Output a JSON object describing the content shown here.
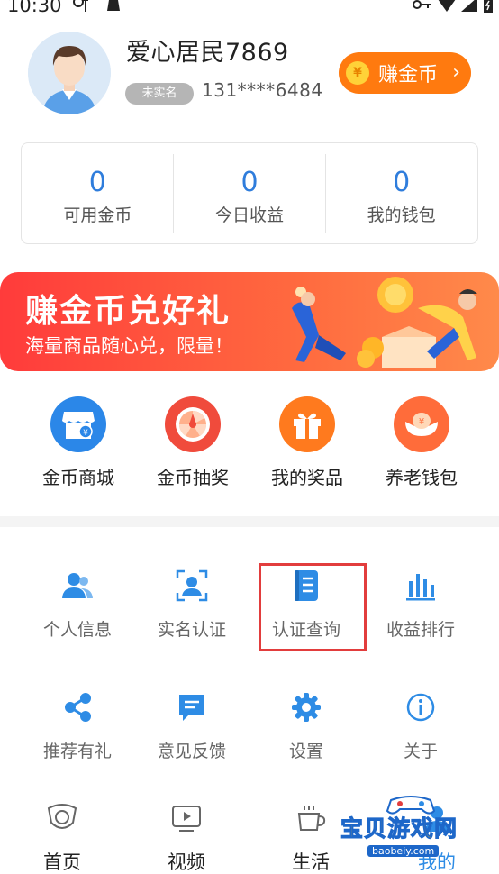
{
  "status_bar": {
    "time": "10:30"
  },
  "profile": {
    "username": "爱心居民7869",
    "verify_badge": "未实名",
    "phone": "131****6484",
    "earn_button": {
      "label": "赚金币",
      "coin_glyph": "¥",
      "chevron": "›"
    }
  },
  "stats": [
    {
      "value": "0",
      "label": "可用金币"
    },
    {
      "value": "0",
      "label": "今日收益"
    },
    {
      "value": "0",
      "label": "我的钱包"
    }
  ],
  "banner": {
    "title": "赚金币兑好礼",
    "subtitle": "海量商品随心兑，限量！"
  },
  "quick_actions": [
    {
      "label": "金币商城",
      "icon": "store-icon",
      "color": "#2b87e8"
    },
    {
      "label": "金币抽奖",
      "icon": "wheel-icon",
      "color": "#f04b3c"
    },
    {
      "label": "我的奖品",
      "icon": "gift-icon",
      "color": "#ff7a1e"
    },
    {
      "label": "养老钱包",
      "icon": "ingot-icon",
      "color": "#ff6c3a"
    }
  ],
  "services": [
    {
      "label": "个人信息",
      "icon": "user-info-icon"
    },
    {
      "label": "实名认证",
      "icon": "face-verify-icon"
    },
    {
      "label": "认证查询",
      "icon": "document-query-icon"
    },
    {
      "label": "收益排行",
      "icon": "ranking-bars-icon"
    },
    {
      "label": "推荐有礼",
      "icon": "share-icon"
    },
    {
      "label": "意见反馈",
      "icon": "feedback-icon"
    },
    {
      "label": "设置",
      "icon": "gear-icon"
    },
    {
      "label": "关于",
      "icon": "info-icon"
    }
  ],
  "bottom_nav": [
    {
      "label": "首页",
      "icon": "home-icon"
    },
    {
      "label": "视频",
      "icon": "video-icon"
    },
    {
      "label": "生活",
      "icon": "cup-icon"
    },
    {
      "label": "我的",
      "icon": "profile-icon"
    }
  ],
  "watermark": {
    "text": "宝贝游戏网",
    "url": "baobeiy.com"
  },
  "colors": {
    "accent": "#2f7ddc",
    "earn_button": "#ff7a0f",
    "highlight_box": "#e23d3d",
    "service_icon": "#2e8ce5"
  }
}
